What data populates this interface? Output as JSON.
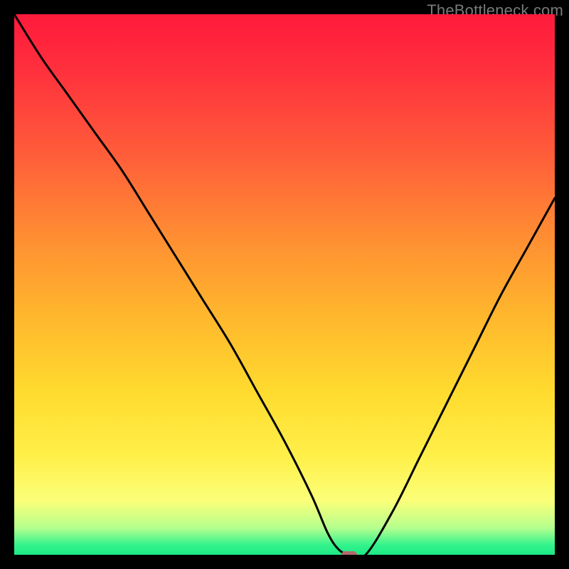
{
  "watermark": {
    "text": "TheBottleneck.com"
  },
  "chart_data": {
    "type": "line",
    "title": "",
    "xlabel": "",
    "ylabel": "",
    "xlim": [
      0,
      100
    ],
    "ylim": [
      0,
      100
    ],
    "grid": false,
    "legend": false,
    "series": [
      {
        "name": "bottleneck-curve",
        "color": "#000000",
        "x": [
          0,
          5,
          10,
          15,
          20,
          25,
          30,
          35,
          40,
          45,
          50,
          55,
          58,
          60,
          62,
          65,
          70,
          75,
          80,
          85,
          90,
          95,
          100
        ],
        "y": [
          100,
          92,
          85,
          78,
          71,
          63,
          55,
          47,
          39,
          30,
          21,
          11,
          4,
          1,
          0,
          0,
          8,
          18,
          28,
          38,
          48,
          57,
          66
        ]
      }
    ],
    "marker": {
      "x": 62,
      "y": 0,
      "color": "#b36b6b"
    },
    "background_gradient": {
      "stops": [
        {
          "pos": 0.0,
          "color": "#ff1a3c"
        },
        {
          "pos": 0.55,
          "color": "#ffdb2e"
        },
        {
          "pos": 0.9,
          "color": "#fbff79"
        },
        {
          "pos": 1.0,
          "color": "#1de985"
        }
      ]
    }
  }
}
